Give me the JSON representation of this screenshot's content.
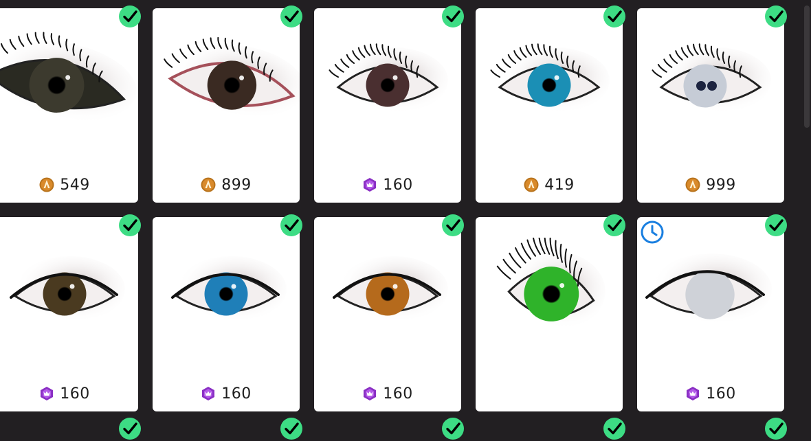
{
  "colors": {
    "background": "#221f22",
    "card": "#ffffff",
    "owned_check": "#3ddc84",
    "gold_coin": "#d98a2b",
    "premium_gem": "#8a2fc4",
    "timer": "#1a7fe0"
  },
  "items": [
    {
      "price": "549",
      "currency": "gold-coin",
      "owned": true,
      "iris": "#3c3a2e",
      "style": "dark-lens"
    },
    {
      "price": "899",
      "currency": "gold-coin",
      "owned": true,
      "iris": "#3a2a22",
      "style": "pink-rim"
    },
    {
      "price": "160",
      "currency": "premium-gem",
      "owned": true,
      "iris": "#4a2f30",
      "style": "smoky"
    },
    {
      "price": "419",
      "currency": "gold-coin",
      "owned": true,
      "iris": "#1b8fb5",
      "style": "blue-lash"
    },
    {
      "price": "999",
      "currency": "gold-coin",
      "owned": true,
      "iris": "#9aa4b5",
      "style": "pale-double"
    },
    {
      "price": "160",
      "currency": "premium-gem",
      "owned": true,
      "iris": "#4a3a20",
      "style": "soft-brown"
    },
    {
      "price": "160",
      "currency": "premium-gem",
      "owned": true,
      "iris": "#1f7fb8",
      "style": "almond-blue"
    },
    {
      "price": "160",
      "currency": "premium-gem",
      "owned": true,
      "iris": "#b56a1c",
      "style": "almond-amber"
    },
    {
      "price": "",
      "currency": "",
      "owned": true,
      "iris": "#2fb32a",
      "style": "green-spiky"
    },
    {
      "price": "160",
      "currency": "premium-gem",
      "owned": true,
      "iris": "#c9ccd2",
      "style": "pale-wide",
      "limited_time": true
    }
  ]
}
